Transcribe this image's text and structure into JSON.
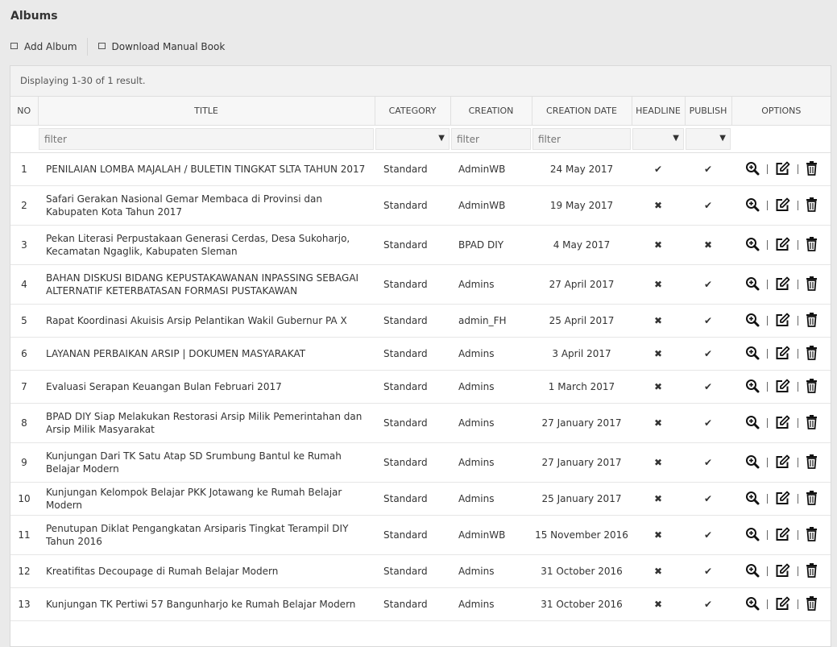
{
  "page": {
    "title": "Albums"
  },
  "toolbar": {
    "add_album": "Add Album",
    "download_manual": "Download Manual Book"
  },
  "grid": {
    "summary": "Displaying 1-30 of 1 result.",
    "columns": [
      "NO",
      "TITLE",
      "CATEGORY",
      "CREATION",
      "CREATION DATE",
      "HEADLINE",
      "PUBLISH",
      "OPTIONS"
    ],
    "filters": {
      "title_placeholder": "filter",
      "creation_placeholder": "filter",
      "date_placeholder": "filter",
      "select_arrow": "▼"
    },
    "rows": [
      {
        "no": "1",
        "title": "PENILAIAN LOMBA MAJALAH / BULETIN TINGKAT SLTA TAHUN 2017",
        "category": "Standard",
        "creation": "AdminWB",
        "date": "24 May 2017",
        "headline": "✔",
        "publish": "✔",
        "headline_state": "yes",
        "publish_state": "yes"
      },
      {
        "no": "2",
        "title": "Safari Gerakan Nasional Gemar Membaca di Provinsi dan Kabupaten Kota Tahun 2017",
        "category": "Standard",
        "creation": "AdminWB",
        "date": "19 May 2017",
        "headline": "✖",
        "publish": "✔",
        "headline_state": "no",
        "publish_state": "yes"
      },
      {
        "no": "3",
        "title": "Pekan Literasi Perpustakaan Generasi Cerdas, Desa Sukoharjo, Kecamatan Ngaglik, Kabupaten Sleman",
        "category": "Standard",
        "creation": "BPAD DIY",
        "date": "4 May 2017",
        "headline": "✖",
        "publish": "✖",
        "headline_state": "no",
        "publish_state": "no"
      },
      {
        "no": "4",
        "title": "BAHAN DISKUSI BIDANG KEPUSTAKAWANAN INPASSING SEBAGAI ALTERNATIF KETERBATASAN FORMASI PUSTAKAWAN",
        "category": "Standard",
        "creation": "Admins",
        "date": "27 April 2017",
        "headline": "✖",
        "publish": "✔",
        "headline_state": "no",
        "publish_state": "yes"
      },
      {
        "no": "5",
        "title": "Rapat Koordinasi Akuisis Arsip Pelantikan Wakil Gubernur PA X",
        "category": "Standard",
        "creation": "admin_FH",
        "date": "25 April 2017",
        "headline": "✖",
        "publish": "✔",
        "headline_state": "no",
        "publish_state": "yes"
      },
      {
        "no": "6",
        "title": "LAYANAN PERBAIKAN ARSIP | DOKUMEN MASYARAKAT",
        "category": "Standard",
        "creation": "Admins",
        "date": "3 April 2017",
        "headline": "✖",
        "publish": "✔",
        "headline_state": "no",
        "publish_state": "yes"
      },
      {
        "no": "7",
        "title": "Evaluasi Serapan Keuangan Bulan Februari 2017",
        "category": "Standard",
        "creation": "Admins",
        "date": "1 March 2017",
        "headline": "✖",
        "publish": "✔",
        "headline_state": "no",
        "publish_state": "yes"
      },
      {
        "no": "8",
        "title": "BPAD DIY Siap Melakukan Restorasi Arsip Milik Pemerintahan dan Arsip Milik Masyarakat",
        "category": "Standard",
        "creation": "Admins",
        "date": "27 January 2017",
        "headline": "✖",
        "publish": "✔",
        "headline_state": "no",
        "publish_state": "yes"
      },
      {
        "no": "9",
        "title": "Kunjungan Dari TK Satu Atap SD Srumbung Bantul ke Rumah Belajar Modern",
        "category": "Standard",
        "creation": "Admins",
        "date": "27 January 2017",
        "headline": "✖",
        "publish": "✔",
        "headline_state": "no",
        "publish_state": "yes"
      },
      {
        "no": "10",
        "title": "Kunjungan Kelompok Belajar PKK Jotawang ke Rumah Belajar Modern",
        "category": "Standard",
        "creation": "Admins",
        "date": "25 January 2017",
        "headline": "✖",
        "publish": "✔",
        "headline_state": "no",
        "publish_state": "yes"
      },
      {
        "no": "11",
        "title": "Penutupan Diklat Pengangkatan Arsiparis Tingkat Terampil DIY Tahun 2016",
        "category": "Standard",
        "creation": "AdminWB",
        "date": "15 November 2016",
        "headline": "✖",
        "publish": "✔",
        "headline_state": "no",
        "publish_state": "yes"
      },
      {
        "no": "12",
        "title": "Kreatifitas Decoupage di Rumah Belajar Modern",
        "category": "Standard",
        "creation": "Admins",
        "date": "31 October 2016",
        "headline": "✖",
        "publish": "✔",
        "headline_state": "no",
        "publish_state": "yes"
      },
      {
        "no": "13",
        "title": "Kunjungan TK Pertiwi 57 Bangunharjo ke Rumah Belajar Modern",
        "category": "Standard",
        "creation": "Admins",
        "date": "31 October 2016",
        "headline": "✖",
        "publish": "✔",
        "headline_state": "no",
        "publish_state": "yes"
      }
    ],
    "options_icons": [
      "view-icon",
      "edit-icon",
      "delete-icon"
    ]
  },
  "colors": {
    "check": "#3aa13a",
    "cross": "#e04848",
    "background": "#eaeaea"
  }
}
